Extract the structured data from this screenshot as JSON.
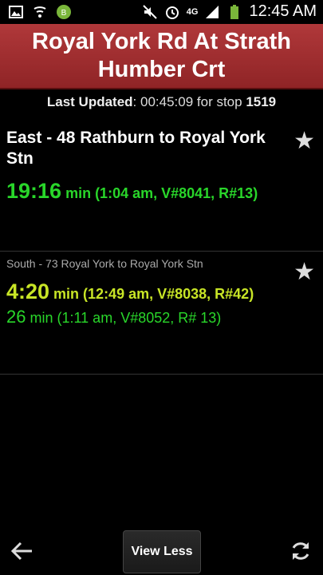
{
  "status_bar": {
    "icons": [
      "image-icon",
      "wifi-share-icon",
      "app-icon",
      "mute-icon",
      "alarm-icon",
      "4g-icon",
      "signal-icon",
      "battery-icon"
    ],
    "network_label": "4G",
    "time": "12:45 AM"
  },
  "header": {
    "title": "Royal York Rd At Strath Humber Crt"
  },
  "last_updated": {
    "label": "Last Updated",
    "time": ": 00:45:09 for stop ",
    "stop": "1519"
  },
  "routes": [
    {
      "title": "East - 48 Rathburn to Royal York Stn",
      "arrivals": [
        {
          "minutes": "19:16",
          "detail": " min (1:04 am, V#8041, R#13)"
        }
      ]
    },
    {
      "title": "South - 73 Royal York to Royal York Stn",
      "arrivals": [
        {
          "minutes": "4:20",
          "detail": " min (12:49 am, V#8038, R#42)"
        },
        {
          "minutes": "26",
          "detail": " min (1:11 am, V#8052, R# 13)"
        }
      ]
    }
  ],
  "bottom": {
    "view_less": "View Less"
  },
  "colors": {
    "header": "#a02d2f",
    "green": "#29d62a",
    "yellow_green": "#c8e526"
  }
}
